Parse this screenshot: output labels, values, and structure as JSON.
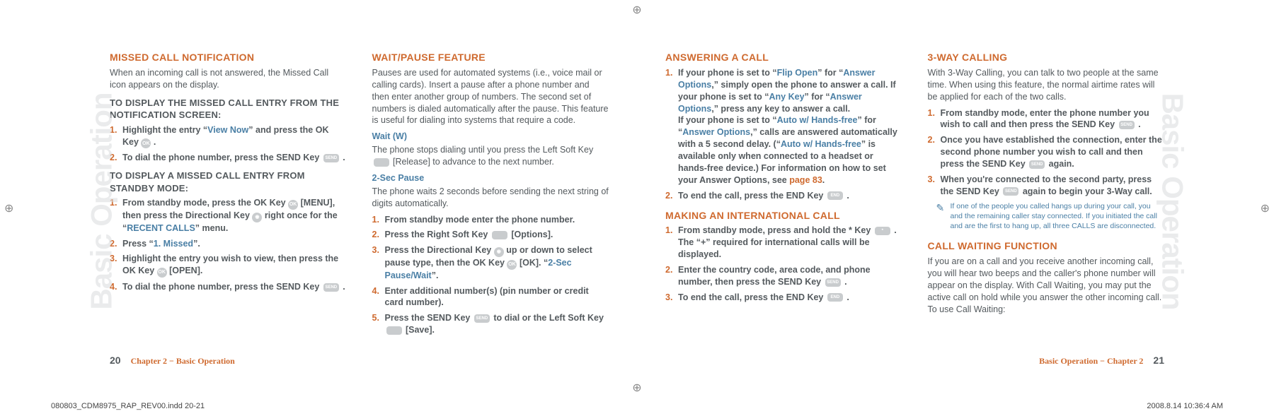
{
  "crop_glyph": "⊕",
  "side_label": "Basic Operation",
  "page_left": {
    "col1": {
      "h_missed": "MISSED CALL NOTIFICATION",
      "p_missed": "When an incoming call is not answered, the Missed Call icon appears on the display.",
      "h_display1": "TO DISPLAY THE MISSED CALL ENTRY FROM THE NOTIFICATION SCREEN:",
      "s1n1": "1.",
      "s1t1a": "Highlight the entry “",
      "s1t1b": "View Now",
      "s1t1c": "” and press the OK Key",
      "s1t1d": ".",
      "s1n2": "2.",
      "s1t2a": "To dial the phone number, press the SEND Key",
      "s1t2b": ".",
      "h_display2": "TO DISPLAY A MISSED CALL ENTRY FROM STANDBY MODE:",
      "s2n1": "1.",
      "s2t1a": "From standby mode, press the OK Key",
      "s2t1b": "[MENU], then press the Directional Key",
      "s2t1c": "right once for the “",
      "s2t1d": "RECENT CALLS",
      "s2t1e": "” menu.",
      "s2n2": "2.",
      "s2t2a": "Press “",
      "s2t2b": "1. Missed",
      "s2t2c": "”.",
      "s2n3": "3.",
      "s2t3a": "Highlight the entry you wish to view, then press the OK Key",
      "s2t3b": "[OPEN].",
      "s2n4": "4.",
      "s2t4a": "To dial the phone number, press the SEND Key",
      "s2t4b": "."
    },
    "col2": {
      "h_wait": "WAIT/PAUSE FEATURE",
      "p_wait": "Pauses are used for automated systems (i.e., voice mail or calling cards). Insert a pause after a phone number and then enter another group of numbers. The second set of numbers is dialed automatically after the pause. This feature is useful for dialing into systems that require a code.",
      "sub_waitw": "Wait (W)",
      "p_waitw_a": "The phone stops dialing until you press the Left Soft Key",
      "p_waitw_b": "[Release] to advance to the next number.",
      "sub_2sec": "2-Sec Pause",
      "p_2sec": "The phone waits 2 seconds before sending the next string of digits automatically.",
      "n1": "1.",
      "t1": "From standby mode enter the phone number.",
      "n2": "2.",
      "t2a": "Press the Right Soft Key",
      "t2b": "[Options].",
      "n3": "3.",
      "t3a": "Press the Directional Key",
      "t3b": "up or down to select pause type, then the OK Key",
      "t3c": "[OK]. “",
      "t3d": "2-Sec Pause/Wait",
      "t3e": "”.",
      "n4": "4.",
      "t4": "Enter additional number(s) (pin number or credit card number).",
      "n5": "5.",
      "t5a": "Press the SEND Key",
      "t5b": "to dial or the Left Soft Key",
      "t5c": "[Save]."
    },
    "footer_num": "20",
    "footer_title": "Chapter 2 − Basic Operation"
  },
  "page_right": {
    "col1": {
      "h_ans": "ANSWERING A CALL",
      "n1": "1.",
      "t1a": "If your phone is set to “",
      "t1b": "Flip Open",
      "t1c": "” for “",
      "t1d": "Answer Options",
      "t1e": ",” simply open the phone to answer a call. If your phone is set to “",
      "t1f": "Any Key",
      "t1g": "” for “",
      "t1h": "Answer Options",
      "t1i": ",” press any key to answer a call.",
      "t1j": "If your phone is set to “",
      "t1k": "Auto w/ Hands-free",
      "t1l": "” for “",
      "t1m": "Answer Options",
      "t1n": ",” calls are answered automatically with a 5 second delay. (“",
      "t1o": "Auto w/ Hands-free",
      "t1p": "” is available only when connected to a headset or hands-free device.) For information on how to set your Answer Options, see ",
      "t1q": "page 83",
      "t1r": ".",
      "n2": "2.",
      "t2a": "To end the call, press the END Key",
      "t2b": ".",
      "h_intl": "MAKING AN INTERNATIONAL CALL",
      "in1": "1.",
      "it1a": "From standby mode, press and hold the * Key",
      "it1b": ". The “+” required for international calls will be displayed.",
      "in2": "2.",
      "it2a": "Enter the country code, area code, and phone number, then press the SEND Key",
      "it2b": ".",
      "in3": "3.",
      "it3a": "To end the call, press the END Key",
      "it3b": "."
    },
    "col2": {
      "h_3way": "3-WAY CALLING",
      "p_3way": "With 3-Way Calling, you can talk to two people at the same time. When using this feature, the normal airtime rates will be applied for each of the two calls.",
      "n1": "1.",
      "t1a": "From standby mode, enter the phone number you wish to call and then press the SEND Key",
      "t1b": ".",
      "n2": "2.",
      "t2a": "Once you have established the connection, enter the second phone number you wish to call and then press the SEND Key",
      "t2b": "again.",
      "n3": "3.",
      "t3a": "When you're connected to the second party, press the SEND Key",
      "t3b": "again to begin your 3-Way call.",
      "note": "If one of the people you called hangs up during your call, you and the remaining caller stay connected. If you initiated the call and are the first to hang up, all three CALLS are disconnected.",
      "h_cw": "CALL WAITING FUNCTION",
      "p_cw": "If you are on a call and you receive another incoming call, you will hear two beeps and the caller's phone number will appear on the display. With Call Waiting, you may put the active call on hold while you answer the other incoming call. To use Call Waiting:"
    },
    "footer_title": "Basic Operation − Chapter 2",
    "footer_num": "21"
  },
  "doc_meta_left": "080803_CDM8975_RAP_REV00.indd   20-21",
  "doc_meta_right": "2008.8.14   10:36:4 AM"
}
